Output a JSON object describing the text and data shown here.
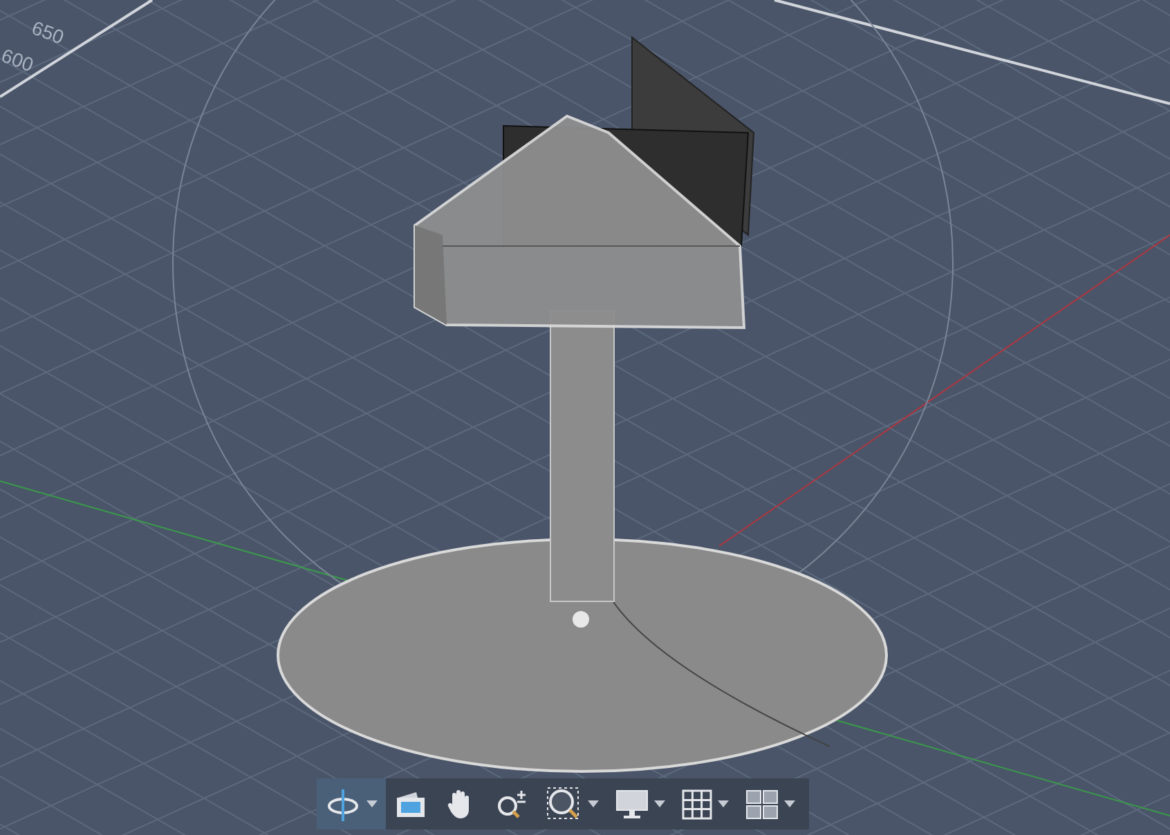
{
  "viewport": {
    "axis_labels": [
      "650",
      "600"
    ]
  },
  "navigation_bar": {
    "tools": [
      {
        "kind": "orbit",
        "selected": true,
        "dropdown": true
      },
      {
        "kind": "camera",
        "selected": false,
        "dropdown": false
      },
      {
        "kind": "pan",
        "selected": false,
        "dropdown": false
      },
      {
        "kind": "zoom",
        "selected": false,
        "dropdown": false
      },
      {
        "kind": "zoom-window",
        "selected": false,
        "dropdown": true
      },
      {
        "kind": "display",
        "selected": false,
        "dropdown": true
      },
      {
        "kind": "grid",
        "selected": false,
        "dropdown": true
      },
      {
        "kind": "viewports",
        "selected": false,
        "dropdown": true
      }
    ]
  }
}
